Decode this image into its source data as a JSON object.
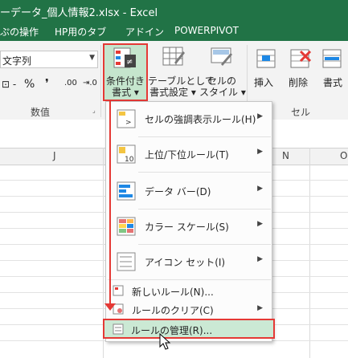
{
  "window": {
    "title": "ーデータ_個人情報2.xlsx - Excel"
  },
  "tabs": [
    {
      "label": "ぷの操作"
    },
    {
      "label": "HP用のタブ"
    },
    {
      "label": "アドイン"
    },
    {
      "label": "POWERPIVOT"
    }
  ],
  "ribbon": {
    "number_format": "文字列",
    "currency_symbol": "⊡ -",
    "percent": "%",
    "comma": "❜",
    "dec_increase": ".00",
    "dec_decrease": "⇥.0",
    "groups": {
      "number": "数值",
      "cells": "セル"
    },
    "buttons": {
      "conditional_format": [
        "条件付き",
        "書式 ▾"
      ],
      "format_table": [
        "テーブルとして",
        "書式設定 ▾"
      ],
      "cell_style": [
        "セルの",
        "スタイル ▾"
      ],
      "insert": "挿入",
      "delete": "削除",
      "format": "書式"
    }
  },
  "sheet": {
    "columns": [
      "J",
      "N",
      "O"
    ]
  },
  "menu": {
    "items": [
      {
        "label": "セルの強調表示ルール(H)",
        "has_submenu": true
      },
      {
        "label": "上位/下位ルール(T)",
        "has_submenu": true
      },
      {
        "label": "データ バー(D)",
        "has_submenu": true
      },
      {
        "label": "カラー スケール(S)",
        "has_submenu": true
      },
      {
        "label": "アイコン セット(I)",
        "has_submenu": true
      }
    ],
    "small_items": [
      {
        "label": "新しいルール(N)...",
        "has_submenu": false
      },
      {
        "label": "ルールのクリア(C)",
        "has_submenu": true
      },
      {
        "label": "ルールの管理(R)...",
        "has_submenu": false
      }
    ]
  },
  "colors": {
    "excel_green": "#217346",
    "highlight": "#e53935",
    "selected": "#c5e5cd"
  }
}
